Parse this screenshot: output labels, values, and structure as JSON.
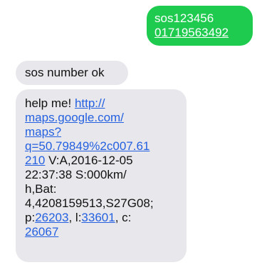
{
  "thread": {
    "outgoing": [
      {
        "line1": "sos123456",
        "phone": "01719563492"
      }
    ],
    "incoming": [
      {
        "text": "sos number ok"
      },
      {
        "prefix": "help me! ",
        "link_part1": "http://",
        "link_part2": "maps.google.com/",
        "link_part3": "maps?",
        "link_part4": "q=50.79849%2c007.61",
        "link_part5": "210",
        "after_link": "  V:A,2016-12-05",
        "line_time": "22:37:38 S:000km/",
        "line_bat": "h,Bat:",
        "line_codes": "4,4208159513,S27G08;",
        "p_label": "p:",
        "p_value": "26203",
        "l_label": ", l:",
        "l_value": "33601",
        "c_label": ", c:",
        "c_value": "26067"
      }
    ]
  }
}
